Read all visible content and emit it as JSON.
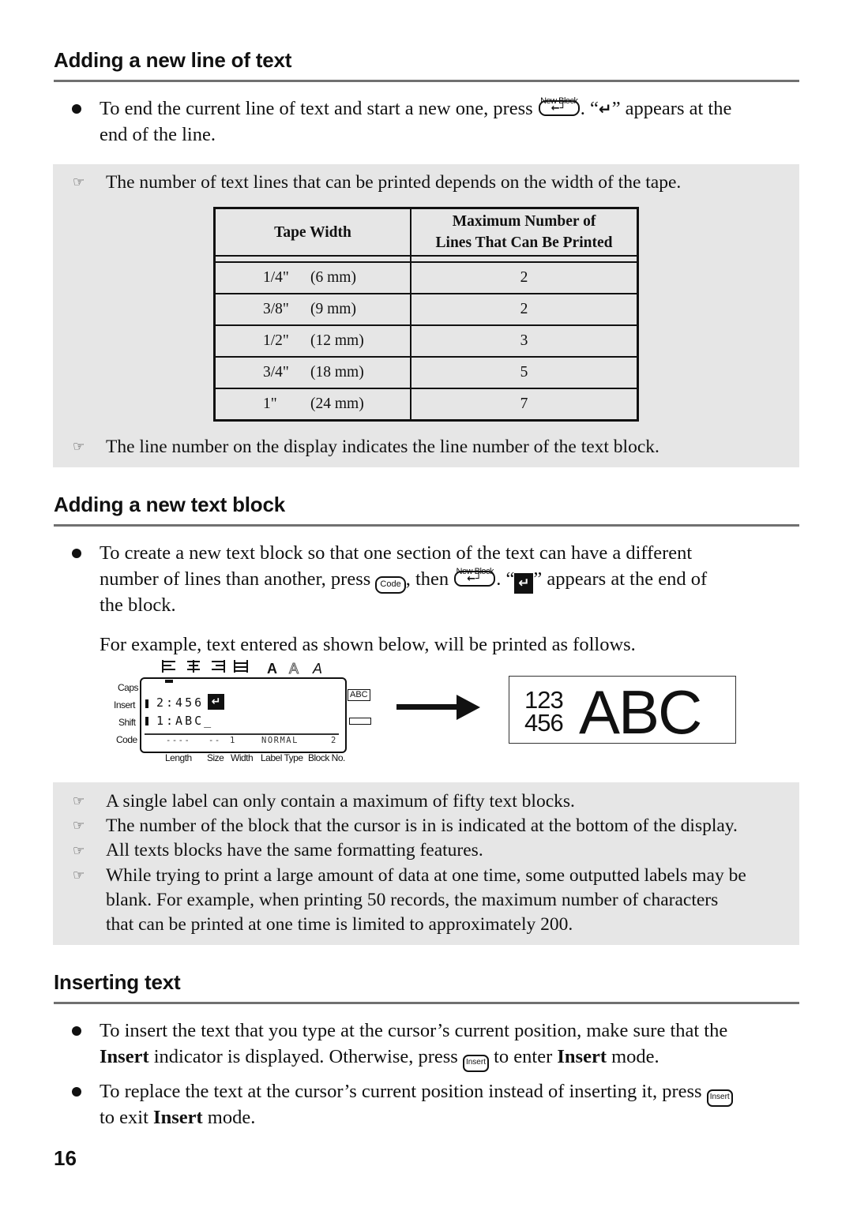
{
  "sections": {
    "new_line": {
      "heading": "Adding a new line of text",
      "bullet1_part1": "To end the current line of text and start a new one, press",
      "bullet1_key_label": "New Block",
      "bullet1_part2": ". “",
      "bullet1_glyph": "↵",
      "bullet1_part3": "” appears at the",
      "bullet1_line2": "end of the line.",
      "note1": "The number of text lines that can be printed depends on the width of the tape.",
      "note2": "The line number on the display indicates the line number of the text block.",
      "table": {
        "headers": [
          "Tape Width",
          "Maximum Number of",
          "Lines That Can Be Printed"
        ],
        "rows": [
          {
            "inch": "1/4\"",
            "mm": "(6 mm)",
            "lines": "2"
          },
          {
            "inch": "3/8\"",
            "mm": "(9 mm)",
            "lines": "2"
          },
          {
            "inch": "1/2\"",
            "mm": "(12 mm)",
            "lines": "3"
          },
          {
            "inch": "3/4\"",
            "mm": "(18 mm)",
            "lines": "5"
          },
          {
            "inch": "1\"",
            "mm": "(24 mm)",
            "lines": "7"
          }
        ]
      }
    },
    "new_block": {
      "heading": "Adding a new text block",
      "line1": "To create a new text block so that one section of the text can have a different",
      "line2_part1": "number of lines than another, press",
      "code_key": "Code",
      "line2_part2": ", then",
      "enter_key_label": "New Block",
      "line2_part3": ". “",
      "glyph": "↵",
      "line2_part4": "” appears at the end of",
      "line3": "the block.",
      "example": "For example, text entered as shown below, will be printed as follows.",
      "display": {
        "left_labels": [
          "Caps",
          "Insert",
          "Shift",
          "Code"
        ],
        "line2": "2:456",
        "line1": "1:ABC_",
        "status": [
          "----",
          "--",
          "1",
          "NORMAL",
          "2"
        ],
        "bottom_labels": [
          "Length",
          "Size",
          "Width",
          "Label Type",
          "Block No."
        ],
        "style_letters": [
          "A",
          "A",
          "A"
        ],
        "right_badge": "ABC",
        "format_icons": [
          "align-left",
          "align-center",
          "align-right",
          "justify"
        ]
      },
      "printed_label": {
        "small_line1": "123",
        "small_line2": "456",
        "big": "ABC"
      },
      "notes": [
        "A single label can only contain a maximum of fifty text blocks.",
        "The number of the block that the cursor is in is indicated at the bottom of the display.",
        "All texts blocks have the same formatting features.",
        "While trying to print a large amount of data at one time, some outputted labels may be",
        "blank. For example, when printing 50 records, the maximum number of characters",
        "that can be printed at one time is limited to approximately 200."
      ]
    },
    "inserting": {
      "heading": "Inserting text",
      "b1_line1": "To insert the text that you type at the cursor’s current position, make sure that the",
      "b1_bold1": "Insert",
      "b1_part2": " indicator is displayed. Otherwise, press ",
      "insert_key": "Insert",
      "b1_part3": " to enter ",
      "b1_bold2": "Insert",
      "b1_part4": " mode.",
      "b2_line1": "To replace the text at the cursor’s current position instead of inserting it, press",
      "b2_part1": "to exit ",
      "b2_bold": "Insert",
      "b2_part2": " mode."
    }
  },
  "page_number": "16",
  "icons": {
    "note_hand": "☞",
    "arrow": "right-arrow"
  }
}
